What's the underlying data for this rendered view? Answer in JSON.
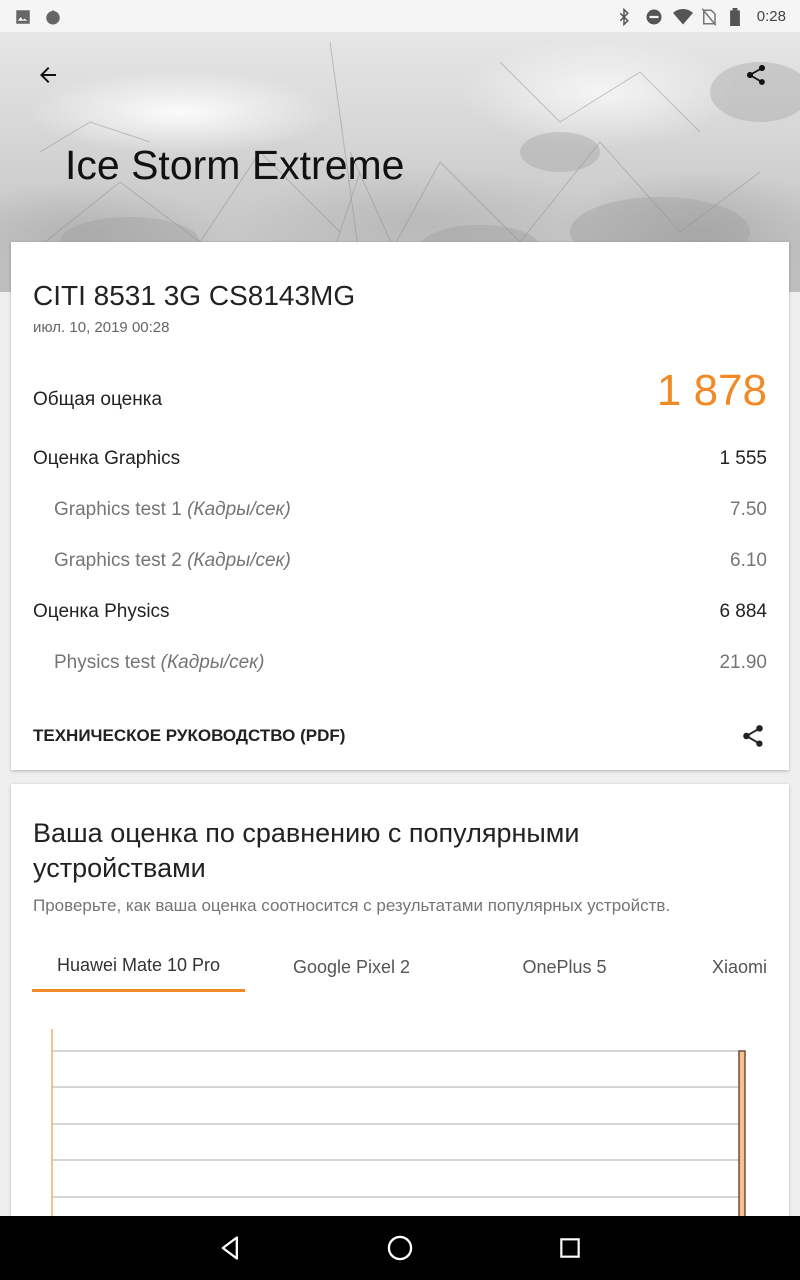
{
  "status_bar": {
    "time": "0:28",
    "left_icons": [
      "image-icon",
      "app-notification-icon"
    ],
    "right_icons": [
      "bluetooth-icon",
      "do-not-disturb-icon",
      "wifi-icon",
      "no-sim-icon",
      "battery-icon"
    ]
  },
  "header": {
    "title": "Ice Storm Extreme",
    "back_icon": "arrow-back-icon",
    "share_icon": "share-icon"
  },
  "result": {
    "device": "CITI 8531 3G CS8143MG",
    "date": "июл. 10, 2019 00:28",
    "overall_label": "Общая оценка",
    "overall_value": "1 878",
    "graphics_label": "Оценка Graphics",
    "graphics_value": "1 555",
    "graphics_test1_label": "Graphics test 1",
    "graphics_test1_unit": "(Кадры/сек)",
    "graphics_test1_value": "7.50",
    "graphics_test2_label": "Graphics test 2",
    "graphics_test2_unit": "(Кадры/сек)",
    "graphics_test2_value": "6.10",
    "physics_label": "Оценка Physics",
    "physics_value": "6 884",
    "physics_test_label": "Physics test",
    "physics_test_unit": "(Кадры/сек)",
    "physics_test_value": "21.90",
    "tech_guide": "ТЕХНИЧЕСКОЕ РУКОВОДСТВО (PDF)"
  },
  "compare": {
    "title": "Ваша оценка по сравнению с популярными устройствами",
    "subtitle": "Проверьте, как ваша оценка соотносится с результатами популярных устройств.",
    "tabs": [
      {
        "label": "Huawei Mate 10 Pro",
        "active": true
      },
      {
        "label": "Google Pixel 2",
        "active": false
      },
      {
        "label": "OnePlus 5",
        "active": false
      },
      {
        "label": "Xiaomi",
        "active": false
      }
    ]
  },
  "colors": {
    "accent": "#f18a26",
    "bar_dark": "#6d4c41",
    "bar_light": "#f4c28e"
  }
}
